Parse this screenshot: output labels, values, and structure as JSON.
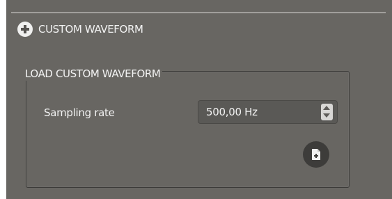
{
  "section": {
    "title": "CUSTOM WAVEFORM",
    "icon": "plus-circle-icon"
  },
  "group": {
    "title": "LOAD CUSTOM WAVEFORM"
  },
  "sampling_rate": {
    "label": "Sampling rate",
    "value": "500,00 Hz"
  },
  "load_button": {
    "icon": "add-file-icon"
  },
  "colors": {
    "panel_background": "#686662",
    "text": "#f2f2f2",
    "button_background": "#3d3c3a"
  }
}
